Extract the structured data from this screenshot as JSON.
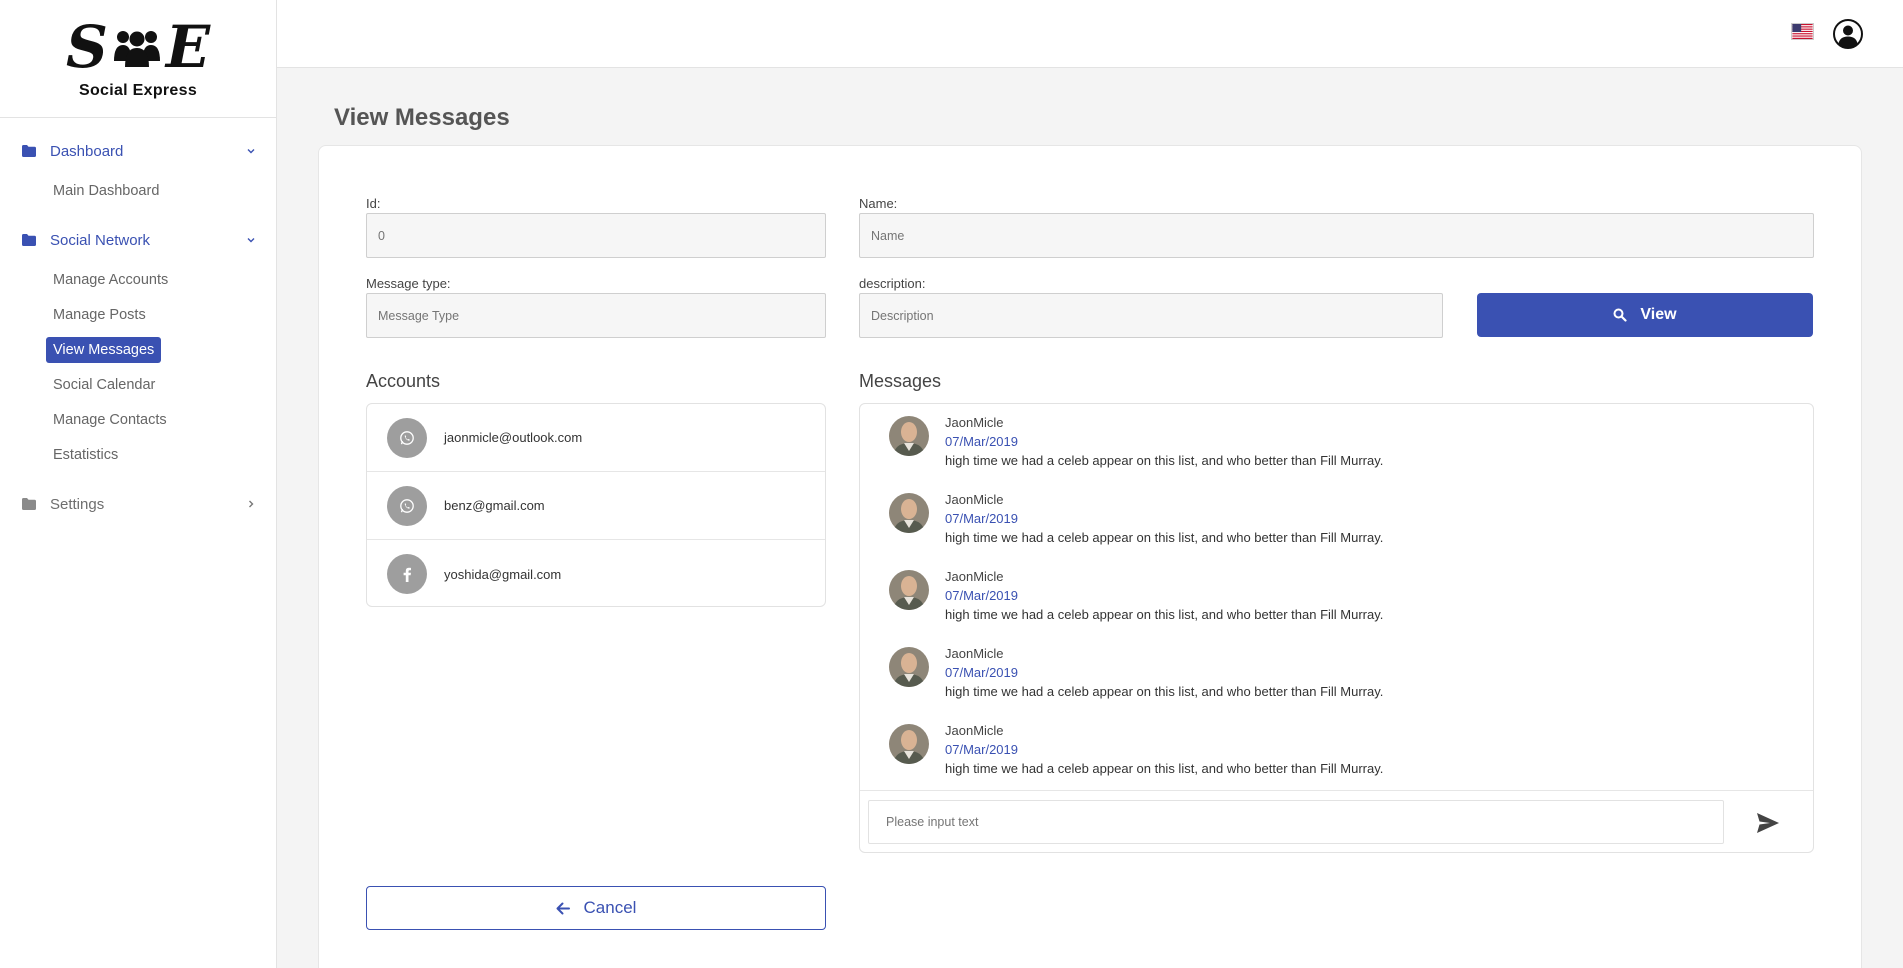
{
  "brand": {
    "logo_letters": [
      "S",
      "E"
    ],
    "name": "Social Express"
  },
  "sidebar": {
    "groups": [
      {
        "label": "Dashboard",
        "icon": "folder-icon",
        "expanded": true,
        "items": [
          "Main Dashboard"
        ]
      },
      {
        "label": "Social Network",
        "icon": "folder-icon",
        "expanded": true,
        "items": [
          "Manage Accounts",
          "Manage Posts",
          "View Messages",
          "Social Calendar",
          "Manage Contacts",
          "Estatistics"
        ]
      },
      {
        "label": "Settings",
        "icon": "folder-icon",
        "expanded": false,
        "items": []
      }
    ],
    "active_item": "View Messages"
  },
  "topbar": {
    "flag_icon": "us-flag-icon",
    "user_icon": "user-circle-icon"
  },
  "page": {
    "title": "View Messages",
    "form": {
      "id_label": "Id:",
      "id_placeholder": "0",
      "name_label": "Name:",
      "name_placeholder": "Name",
      "type_label": "Message type:",
      "type_placeholder": "Message Type",
      "desc_label": "description:",
      "desc_placeholder": "Description",
      "view_button": "View"
    },
    "accounts": {
      "title": "Accounts",
      "items": [
        {
          "email": "jaonmicle@outlook.com",
          "icon": "whatsapp-icon"
        },
        {
          "email": "benz@gmail.com",
          "icon": "whatsapp-icon"
        },
        {
          "email": "yoshida@gmail.com",
          "icon": "facebook-icon"
        }
      ]
    },
    "messages": {
      "title": "Messages",
      "items": [
        {
          "name": "JaonMicle",
          "date": "07/Mar/2019",
          "text": "high time we had a celeb appear on this list, and who better than Fill Murray."
        },
        {
          "name": "JaonMicle",
          "date": "07/Mar/2019",
          "text": "high time we had a celeb appear on this list, and who better than Fill Murray."
        },
        {
          "name": "JaonMicle",
          "date": "07/Mar/2019",
          "text": "high time we had a celeb appear on this list, and who better than Fill Murray."
        },
        {
          "name": "JaonMicle",
          "date": "07/Mar/2019",
          "text": "high time we had a celeb appear on this list, and who better than Fill Murray."
        },
        {
          "name": "JaonMicle",
          "date": "07/Mar/2019",
          "text": "high time we had a celeb appear on this list, and who better than Fill Murray."
        }
      ],
      "input_placeholder": "Please input text"
    },
    "cancel_button": "Cancel"
  },
  "colors": {
    "accent": "#3a51b2",
    "muted_icon": "#9e9e9e"
  }
}
